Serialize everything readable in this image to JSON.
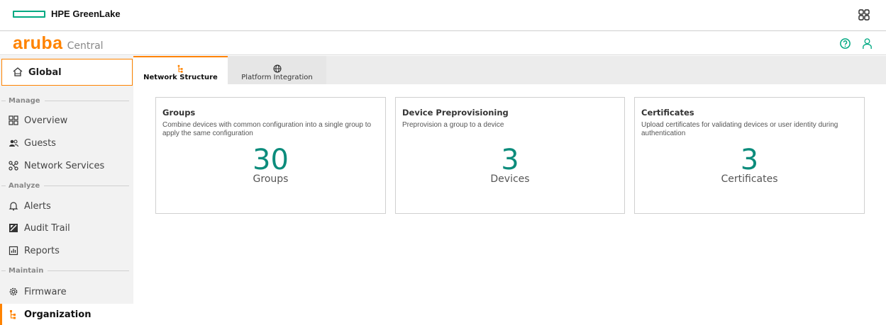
{
  "topbar": {
    "brand": "HPE GreenLake",
    "apps_icon": "grid-icon"
  },
  "header": {
    "logo": "aruba",
    "product": "Central",
    "icons": [
      "help-icon",
      "user-icon"
    ]
  },
  "sidebar": {
    "global_label": "Global",
    "sections": {
      "manage": "Manage",
      "analyze": "Analyze",
      "maintain": "Maintain"
    },
    "items": [
      {
        "label": "Overview",
        "icon": "dashboard-icon"
      },
      {
        "label": "Guests",
        "icon": "guests-icon"
      },
      {
        "label": "Network Services",
        "icon": "network-services-icon"
      },
      {
        "label": "Alerts",
        "icon": "bell-icon"
      },
      {
        "label": "Audit Trail",
        "icon": "audit-trail-icon"
      },
      {
        "label": "Reports",
        "icon": "reports-icon"
      },
      {
        "label": "Firmware",
        "icon": "firmware-icon"
      },
      {
        "label": "Organization",
        "icon": "organization-icon",
        "active": true
      }
    ]
  },
  "tabs": [
    {
      "label": "Network Structure",
      "icon": "hierarchy-icon",
      "active": true
    },
    {
      "label": "Platform Integration",
      "icon": "globe-icon",
      "active": false
    }
  ],
  "cards": [
    {
      "title": "Groups",
      "description": "Combine devices with common configuration into a single group to apply the same configuration",
      "count": "30",
      "unit": "Groups"
    },
    {
      "title": "Device Preprovisioning",
      "description": "Preprovision a group to a device",
      "count": "3",
      "unit": "Devices"
    },
    {
      "title": "Certificates",
      "description": "Upload certificates for validating devices or user identity during authentication",
      "count": "3",
      "unit": "Certificates"
    }
  ],
  "colors": {
    "accent": "#ff8300",
    "count": "#0c8c7c",
    "hpe_green": "#01a982"
  }
}
